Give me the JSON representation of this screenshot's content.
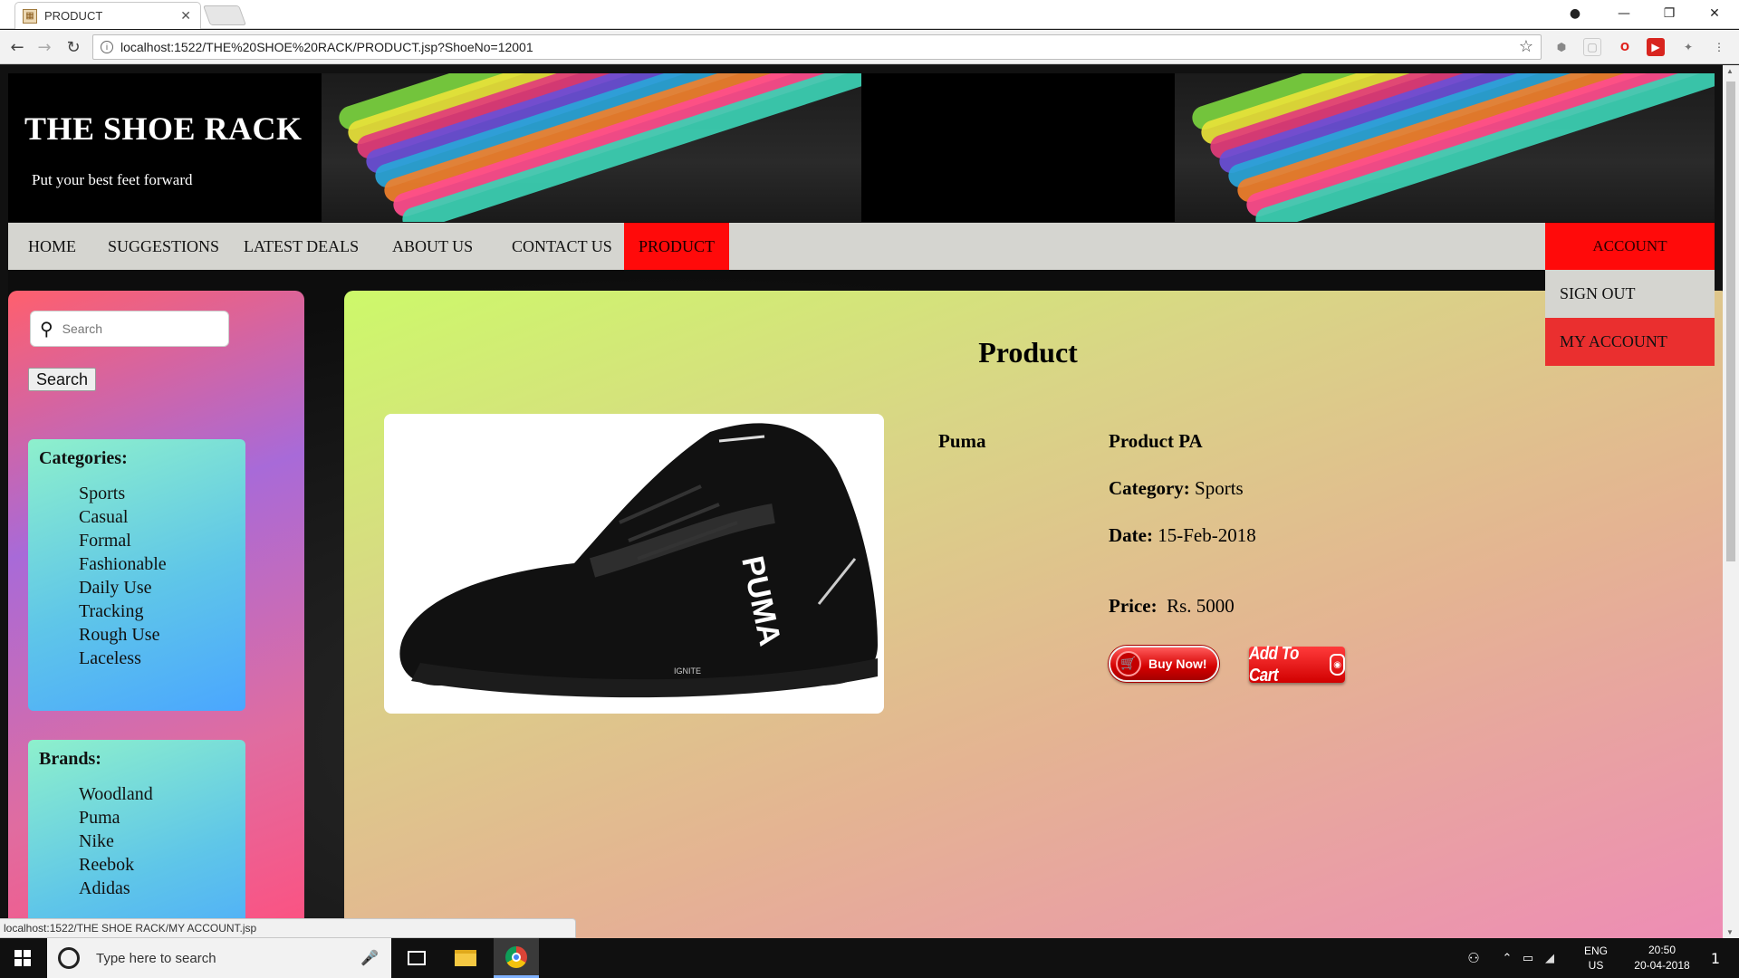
{
  "browser": {
    "tab_title": "PRODUCT",
    "url": "localhost:1522/THE%20SHOE%20RACK/PRODUCT.jsp?ShoeNo=12001",
    "status_url": "localhost:1522/THE SHOE RACK/MY ACCOUNT.jsp",
    "icons": {
      "back": "arrow-left-icon",
      "forward": "arrow-right-icon",
      "reload": "reload-icon",
      "bookmark": "star-icon",
      "menu": "kebab-menu-icon"
    }
  },
  "site": {
    "brand_title": "THE SHOE RACK",
    "tagline": "Put your best feet forward",
    "nav": [
      {
        "label": "HOME",
        "active": false
      },
      {
        "label": "SUGGESTIONS",
        "active": false
      },
      {
        "label": "LATEST DEALS",
        "active": false
      },
      {
        "label": "ABOUT US",
        "active": false
      },
      {
        "label": "CONTACT US",
        "active": false
      },
      {
        "label": "PRODUCT",
        "active": true
      }
    ],
    "account": {
      "label": "ACCOUNT",
      "items": [
        "SIGN OUT",
        "MY ACCOUNT"
      ]
    },
    "colors": {
      "accent_red": "#ff0a0a",
      "nav_bg": "#d5d5d0"
    }
  },
  "sidebar": {
    "search_placeholder": "Search",
    "search_button": "Search",
    "categories_title": "Categories:",
    "categories": [
      "Sports",
      "Casual",
      "Formal",
      "Fashionable",
      "Daily Use",
      "Tracking",
      "Rough Use",
      "Laceless"
    ],
    "brands_title": "Brands:",
    "brands": [
      "Woodland",
      "Puma",
      "Nike",
      "Reebok",
      "Adidas"
    ]
  },
  "product": {
    "page_title": "Product",
    "brand": "Puma",
    "name": "Product PA",
    "category_label": "Category:",
    "category_value": "Sports",
    "date_label": "Date:",
    "date_value": "15-Feb-2018",
    "price_label": "Price:",
    "price_value": "Rs. 5000",
    "buy_now_label": "Buy Now!",
    "add_to_cart_label": "Add To Cart",
    "image_logo_text": "PUMA",
    "image_model_text": "IGNITE"
  },
  "taskbar": {
    "search_placeholder": "Type here to search",
    "lang_primary": "ENG",
    "lang_secondary": "US",
    "time": "20:50",
    "date": "20-04-2018",
    "notification_count": "1"
  }
}
